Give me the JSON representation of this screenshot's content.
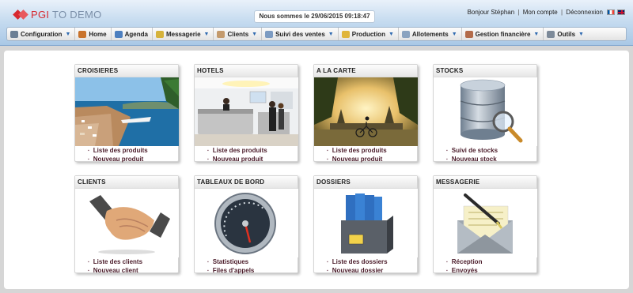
{
  "header": {
    "logo_text_a": "PGI",
    "logo_text_b": " TO DEMO",
    "date_text": "Nous sommes le 29/06/2015 09:18:47",
    "user_greeting": "Bonjour Stéphan",
    "account_link": "Mon compte",
    "logout_link": "Déconnexion",
    "separator": "|"
  },
  "nav": [
    {
      "label": "Configuration",
      "icon": "wrench-icon",
      "color": "#6b7f95",
      "dropdown": true
    },
    {
      "label": "Home",
      "icon": "home-icon",
      "color": "#c9732c",
      "dropdown": false
    },
    {
      "label": "Agenda",
      "icon": "calendar-icon",
      "color": "#4d7fbf",
      "dropdown": false
    },
    {
      "label": "Messagerie",
      "icon": "mail-icon",
      "color": "#d6b23a",
      "dropdown": true
    },
    {
      "label": "Clients",
      "icon": "handshake-icon",
      "color": "#c49a6c",
      "dropdown": true
    },
    {
      "label": "Suivi des ventes",
      "icon": "sales-icon",
      "color": "#7c9bc2",
      "dropdown": true
    },
    {
      "label": "Production",
      "icon": "folder-icon",
      "color": "#e0b53a",
      "dropdown": true
    },
    {
      "label": "Allotements",
      "icon": "grid-icon",
      "color": "#8aa3c0",
      "dropdown": true
    },
    {
      "label": "Gestion financière",
      "icon": "finance-icon",
      "color": "#b36b4a",
      "dropdown": true
    },
    {
      "label": "Outils",
      "icon": "tools-icon",
      "color": "#7d8a99",
      "dropdown": true
    }
  ],
  "cards": [
    {
      "title": "CROISIERES",
      "image": "cruise-port-photo",
      "links": [
        "Liste des produits",
        "Nouveau produit"
      ]
    },
    {
      "title": "HOTELS",
      "image": "hotel-lobby-photo",
      "links": [
        "Liste des produits",
        "Nouveau produit"
      ]
    },
    {
      "title": "A LA CARTE",
      "image": "temple-cyclist-photo",
      "links": [
        "Liste des produits",
        "Nouveau produit"
      ]
    },
    {
      "title": "STOCKS",
      "image": "database-magnifier-icon",
      "links": [
        "Suivi de stocks",
        "Nouveau stock"
      ]
    },
    {
      "title": "CLIENTS",
      "image": "handshake-icon",
      "links": [
        "Liste des clients",
        "Nouveau client"
      ]
    },
    {
      "title": "TABLEAUX DE BORD",
      "image": "speedometer-icon",
      "links": [
        "Statistiques",
        "Files d'appels"
      ]
    },
    {
      "title": "DOSSIERS",
      "image": "binders-icon",
      "links": [
        "Liste des dossiers",
        "Nouveau dossier"
      ]
    },
    {
      "title": "MESSAGERIE",
      "image": "envelope-pen-icon",
      "links": [
        "Réception",
        "Envoyés"
      ]
    }
  ]
}
